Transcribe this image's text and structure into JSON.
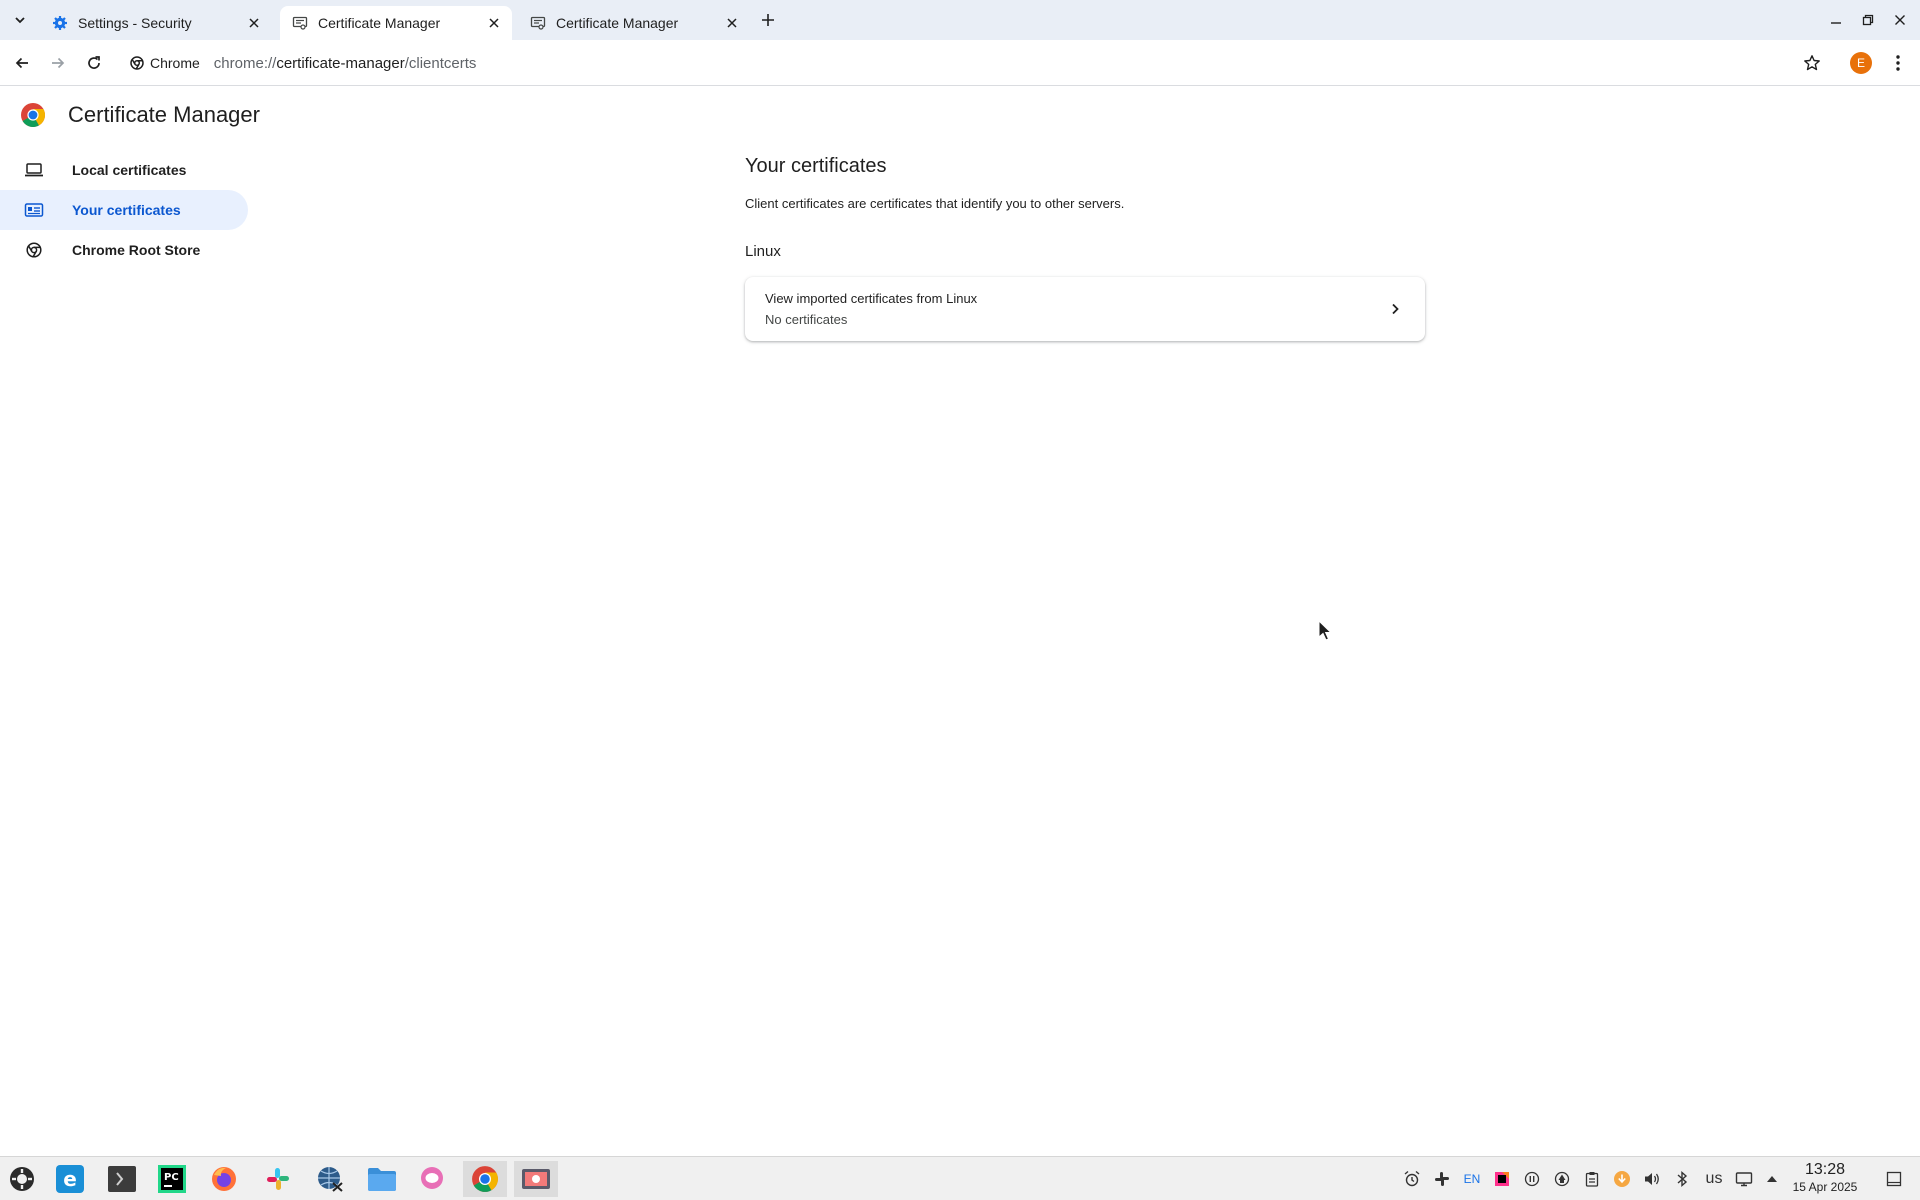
{
  "tabs": [
    {
      "title": "Settings - Security",
      "icon": "gear-icon",
      "active": false
    },
    {
      "title": "Certificate Manager",
      "icon": "certificate-icon",
      "active": true
    },
    {
      "title": "Certificate Manager",
      "icon": "certificate-icon",
      "active": false
    }
  ],
  "toolbar": {
    "chip_label": "Chrome",
    "url_scheme": "chrome://",
    "url_host": "certificate-manager",
    "url_path": "/clientcerts",
    "avatar_letter": "E"
  },
  "page": {
    "title": "Certificate Manager"
  },
  "sidenav": {
    "items": [
      {
        "label": "Local certificates",
        "icon": "laptop-icon"
      },
      {
        "label": "Your certificates",
        "icon": "id-card-icon",
        "selected": true
      },
      {
        "label": "Chrome Root Store",
        "icon": "chrome-icon"
      }
    ]
  },
  "main": {
    "heading": "Your certificates",
    "description": "Client certificates are certificates that identify you to other servers.",
    "section_label": "Linux",
    "card": {
      "primary": "View imported certificates from Linux",
      "secondary": "No certificates"
    }
  },
  "taskbar": {
    "tray_lang": "EN",
    "tray_layout": "us",
    "time": "13:28",
    "date": "15 Apr 2025"
  },
  "colors": {
    "accent": "#0b57d0",
    "selected_bg": "#e8f0fe",
    "tabstrip_bg": "#e9eef6"
  }
}
